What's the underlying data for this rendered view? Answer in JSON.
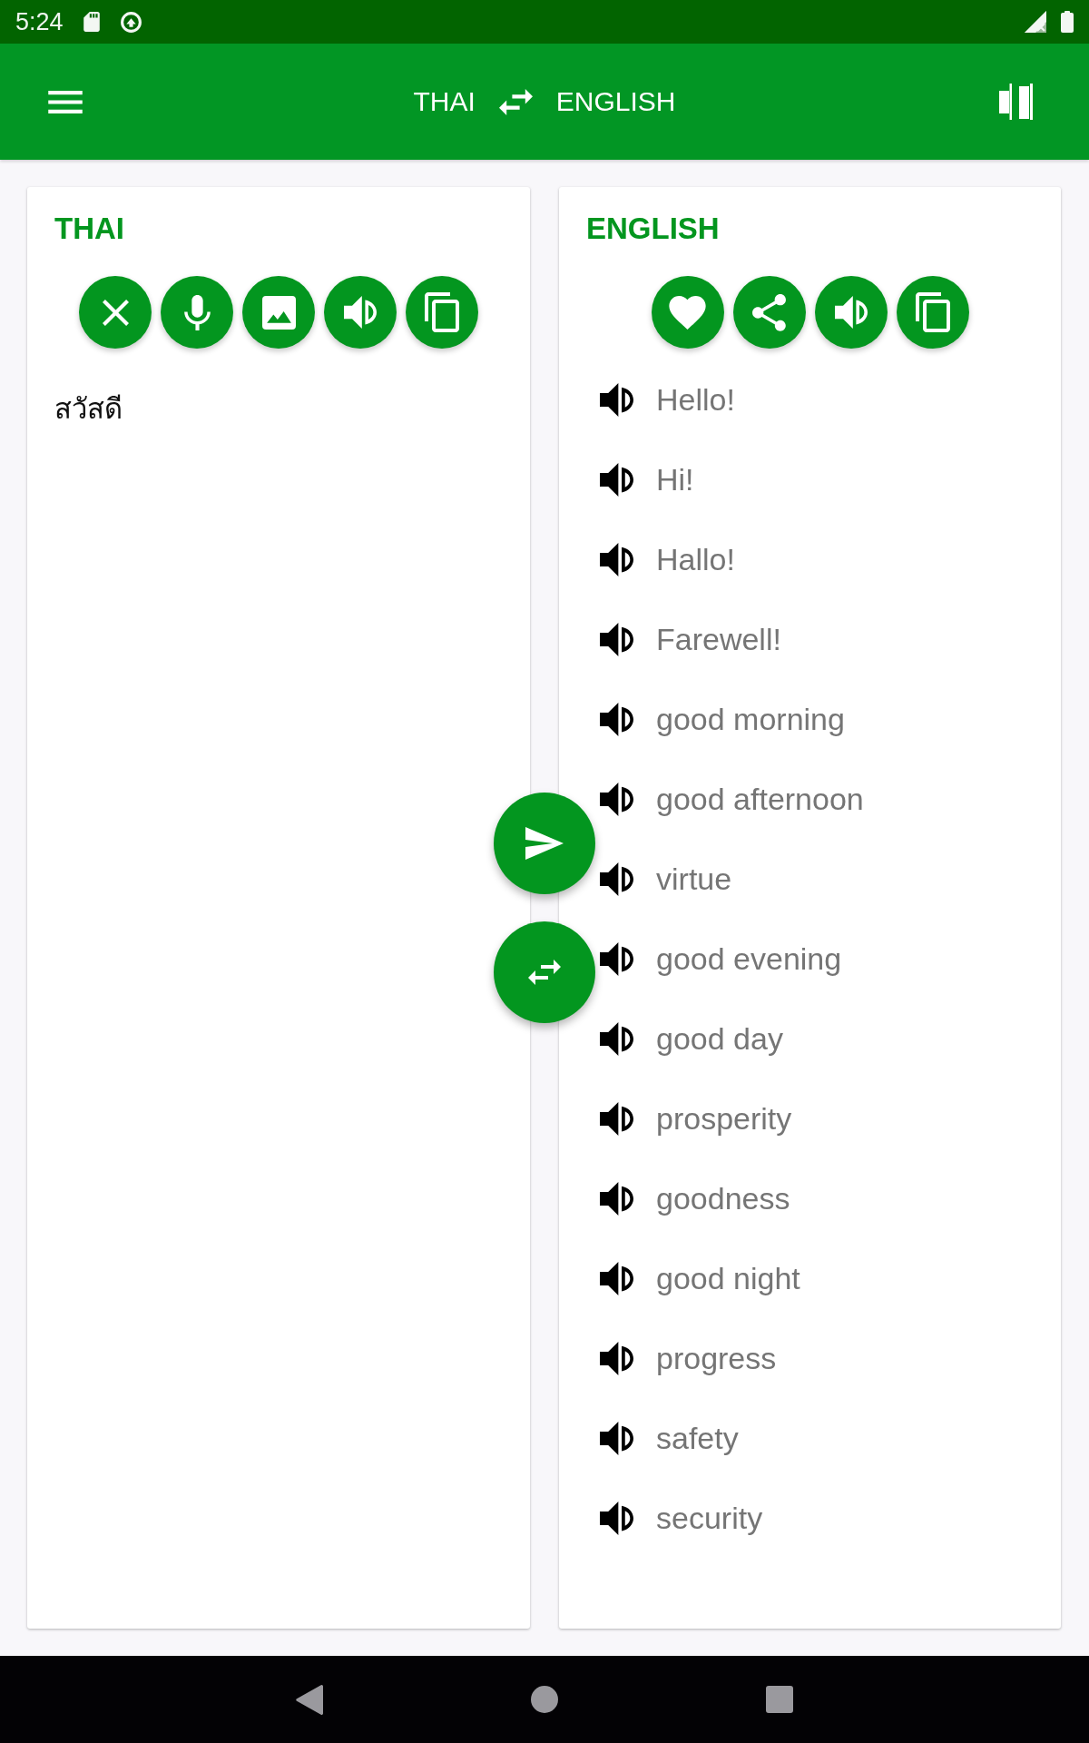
{
  "status_bar": {
    "time": "5:24"
  },
  "app_bar": {
    "source_language": "THAI",
    "target_language": "ENGLISH"
  },
  "source_panel": {
    "title": "THAI",
    "input_text": "สวัสดี"
  },
  "target_panel": {
    "title": "ENGLISH",
    "translations": [
      "Hello!",
      "Hi!",
      "Hallo!",
      "Farewell!",
      "good morning",
      "good afternoon",
      "virtue",
      "good evening",
      "good day",
      "prosperity",
      "goodness",
      "good night",
      "progress",
      "safety",
      "security"
    ]
  }
}
